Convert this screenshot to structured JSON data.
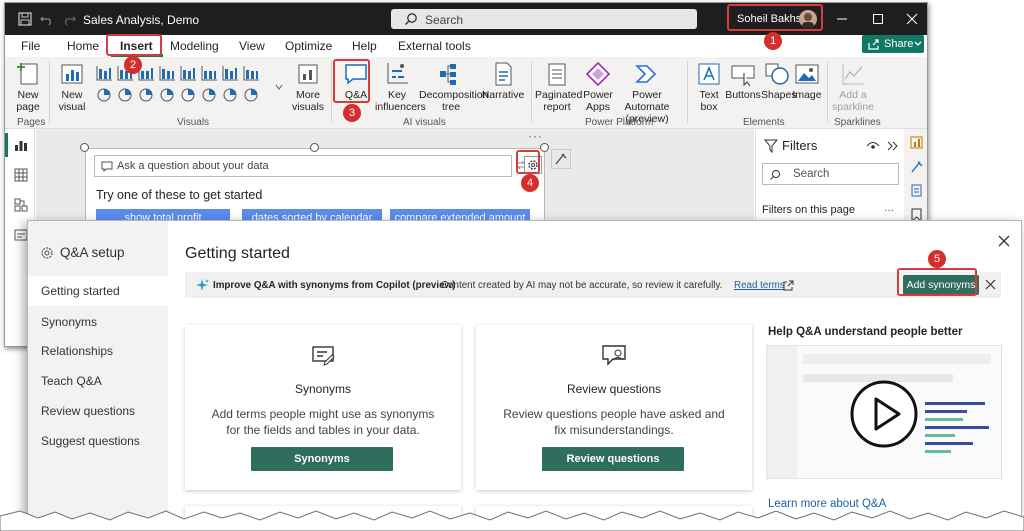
{
  "app": {
    "title": "Sales Analysis, Demo",
    "search_placeholder": "Search",
    "user_name": "Soheil Bakhshi",
    "share_label": "Share"
  },
  "menu": [
    "File",
    "Home",
    "Insert",
    "Modeling",
    "View",
    "Optimize",
    "Help",
    "External tools"
  ],
  "ribbon": {
    "pages": {
      "new_page_1": "New",
      "new_page_2": "page",
      "group": "Pages"
    },
    "visuals": {
      "new_visual_1": "New",
      "new_visual_2": "visual",
      "more_visuals_1": "More",
      "more_visuals_2": "visuals",
      "group": "Visuals"
    },
    "ai": {
      "qa": "Q&A",
      "key_1": "Key",
      "key_2": "influencers",
      "decomp_1": "Decomposition",
      "decomp_2": "tree",
      "narrative": "Narrative",
      "group": "AI visuals"
    },
    "platform": {
      "paginated_1": "Paginated",
      "paginated_2": "report",
      "power_apps_1": "Power",
      "power_apps_2": "Apps",
      "automate_1": "Power Automate",
      "automate_2": "(preview)",
      "group": "Power Platform"
    },
    "elements": {
      "text_1": "Text",
      "text_2": "box",
      "buttons": "Buttons",
      "shapes": "Shapes",
      "image": "Image",
      "group": "Elements"
    },
    "sparklines": {
      "add_1": "Add a",
      "add_2": "sparkline",
      "group": "Sparklines"
    }
  },
  "qa_visual": {
    "input_placeholder": "Ask a question about your data",
    "prompt": "Try one of these to get started",
    "suggestions": [
      "show total profit",
      "dates sorted by calendar",
      "compare extended amount"
    ]
  },
  "filters": {
    "title": "Filters",
    "search_placeholder": "Search",
    "section": "Filters on this page",
    "more": "..."
  },
  "dialog": {
    "title": "Q&A setup",
    "heading": "Getting started",
    "nav": [
      "Getting started",
      "Synonyms",
      "Relationships",
      "Teach Q&A",
      "Review questions",
      "Suggest questions"
    ],
    "banner": {
      "bold": "Improve Q&A with synonyms from Copilot (preview)",
      "text": "Content created by AI may not be accurate, so review it carefully.",
      "link": "Read terms",
      "button": "Add synonyms"
    },
    "cards": [
      {
        "title": "Synonyms",
        "description": "Add terms people might use as synonyms for the fields and tables in your data.",
        "button": "Synonyms"
      },
      {
        "title": "Review questions",
        "description": "Review questions people have asked and fix misunderstandings.",
        "button": "Review questions"
      }
    ],
    "help_title": "Help Q&A understand people better",
    "help_link": "Learn more about Q&A"
  },
  "badges": [
    "1",
    "2",
    "3",
    "4",
    "5"
  ],
  "colors": {
    "accent_green": "#117865",
    "button_green": "#2f6d5d",
    "highlight_red": "#d93b3b",
    "badge_red": "#d32f2f",
    "titlebar": "#1e1e1e"
  }
}
